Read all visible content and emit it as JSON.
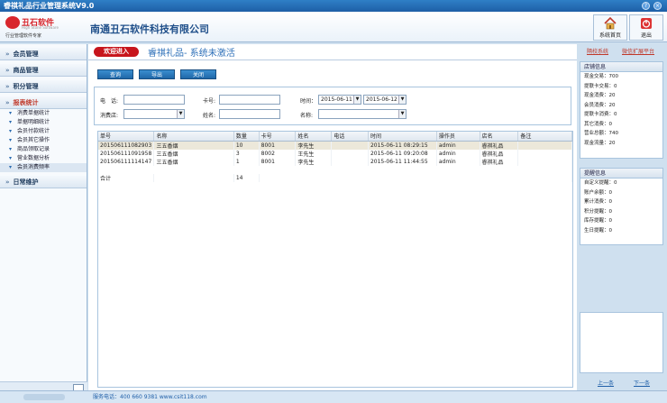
{
  "window": {
    "title": "睿祺礼品行业管理系统V9.0"
  },
  "header": {
    "logo_text": "丑石软件",
    "logo_sub": "High Stone Software",
    "logo_tag": "行业管理软件专家",
    "company": "南通丑石软件科技有限公司",
    "home_label": "系统首页",
    "exit_label": "退出"
  },
  "links": {
    "switch_system": "隔校系统",
    "wechat": "微信扩展平台"
  },
  "sidebar": {
    "sections": [
      {
        "label": "会员管理"
      },
      {
        "label": "商品管理"
      },
      {
        "label": "积分管理"
      },
      {
        "label": "报表统计"
      },
      {
        "label": "日常维护"
      }
    ],
    "report_items": [
      "消费单据统计",
      "单据明细统计",
      "会员付款统计",
      "会员其它操作",
      "商品领取记录",
      "营业数据分析",
      "会员消费频率"
    ]
  },
  "main": {
    "welcome_button": "欢迎进入",
    "banner": "睿祺礼品- 系统未激活",
    "toolbar": {
      "query": "查询",
      "export": "导出",
      "close": "关闭"
    }
  },
  "filter": {
    "phone_label": "电　话:",
    "card_label": "卡号:",
    "time_label": "时间：",
    "date_from": "2015-06-11",
    "date_to": "2015-06-12",
    "store_label": "消费店:",
    "name_label": "姓名:",
    "item_label": "名称:"
  },
  "table": {
    "columns": [
      "单号",
      "名称",
      "数量",
      "卡号",
      "姓名",
      "电话",
      "时间",
      "操作员",
      "店名",
      "备注"
    ],
    "rows": [
      [
        "201506111082903",
        "三五香烟",
        "10",
        "8001",
        "李先生",
        "",
        "2015-06-11 08:29:15",
        "admin",
        "睿祺礼品",
        ""
      ],
      [
        "201506111091958",
        "三五香烟",
        "3",
        "8002",
        "王先生",
        "",
        "2015-06-11 09:20:08",
        "admin",
        "睿祺礼品",
        ""
      ],
      [
        "201506111114147",
        "三五香烟",
        "1",
        "8001",
        "李先生",
        "",
        "2015-06-11 11:44:55",
        "admin",
        "睿祺礼品",
        ""
      ]
    ],
    "total_label": "合计",
    "total_qty": "14"
  },
  "store_info": {
    "title": "店铺信息",
    "rows": [
      "现金交易：700",
      "提联卡交易：0",
      "现金消费：20",
      "会员消费：20",
      "提联卡消费：0",
      "其它消费：0",
      "营业总额：740",
      "现金流量：20"
    ]
  },
  "reminders": {
    "title": "提醒信息",
    "rows": [
      "自定义提醒：0",
      "账户余额：0",
      "累计消费：0",
      "积分提醒：0",
      "库存提醒：0",
      "生日提醒：0"
    ]
  },
  "pager": {
    "prev": "上一条",
    "next": "下一条"
  },
  "status": {
    "phone": "服务电话：400 660 9381  www.csit118.com"
  }
}
